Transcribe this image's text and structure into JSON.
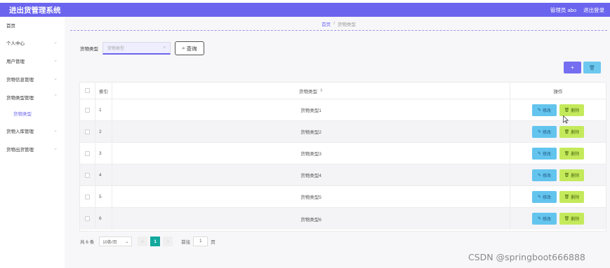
{
  "header": {
    "app_title": "进出货管理系统",
    "user_label": "管理员 abo",
    "logout_label": "退出登录"
  },
  "sidebar": {
    "items": [
      {
        "label": "首页",
        "has_arrow": false
      },
      {
        "label": "个人中心",
        "has_arrow": true
      },
      {
        "label": "用户管理",
        "has_arrow": true
      },
      {
        "label": "货物信息管理",
        "has_arrow": true
      },
      {
        "label": "货物类型管理",
        "has_arrow": true
      },
      {
        "label": "货物类型",
        "has_arrow": false,
        "sub": true
      },
      {
        "label": "货物入库管理",
        "has_arrow": true
      },
      {
        "label": "货物出货管理",
        "has_arrow": true
      }
    ]
  },
  "breadcrumb": {
    "home": "首页",
    "separator": "/",
    "current": "货物类型"
  },
  "search": {
    "label": "货物类型",
    "placeholder": "货物类型",
    "button_label": "查询"
  },
  "toolbar": {
    "add_symbol": "+",
    "delete_symbol": "🗑"
  },
  "table": {
    "headers": {
      "index": "索引",
      "type": "货物类型",
      "ops": "操作"
    },
    "edit_label": "修改",
    "delete_label": "删除",
    "rows": [
      {
        "index": "1",
        "type": "货物类型1"
      },
      {
        "index": "2",
        "type": "货物类型2"
      },
      {
        "index": "3",
        "type": "货物类型3"
      },
      {
        "index": "4",
        "type": "货物类型4"
      },
      {
        "index": "5",
        "type": "货物类型5"
      },
      {
        "index": "6",
        "type": "货物类型6"
      }
    ]
  },
  "pagination": {
    "total_label": "共 6 条",
    "page_size": "10条/页",
    "current_page": "1",
    "goto_label": "前往",
    "goto_value": "1",
    "goto_suffix": "页"
  },
  "watermark": "CSDN @springboot666888",
  "colors": {
    "brand": "#6a64ee",
    "edit": "#63c4ee",
    "delete": "#c4ea5c",
    "page_active": "#13a89e"
  }
}
